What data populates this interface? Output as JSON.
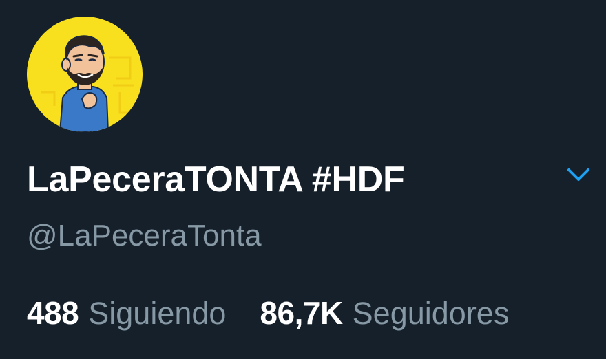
{
  "profile": {
    "display_name": "LaPeceraTONTA #HDF",
    "handle": "@LaPeceraTonta",
    "avatar": {
      "icon": "cartoon-man-avatar",
      "background": "#f8e01f"
    },
    "menu_icon": "chevron-down-icon"
  },
  "stats": {
    "following": {
      "count": "488",
      "label": "Siguiendo"
    },
    "followers": {
      "count": "86,7K",
      "label": "Seguidores"
    }
  },
  "colors": {
    "background": "#15202b",
    "primary_text": "#ffffff",
    "secondary_text": "#8899a6",
    "accent": "#1da1f2"
  }
}
